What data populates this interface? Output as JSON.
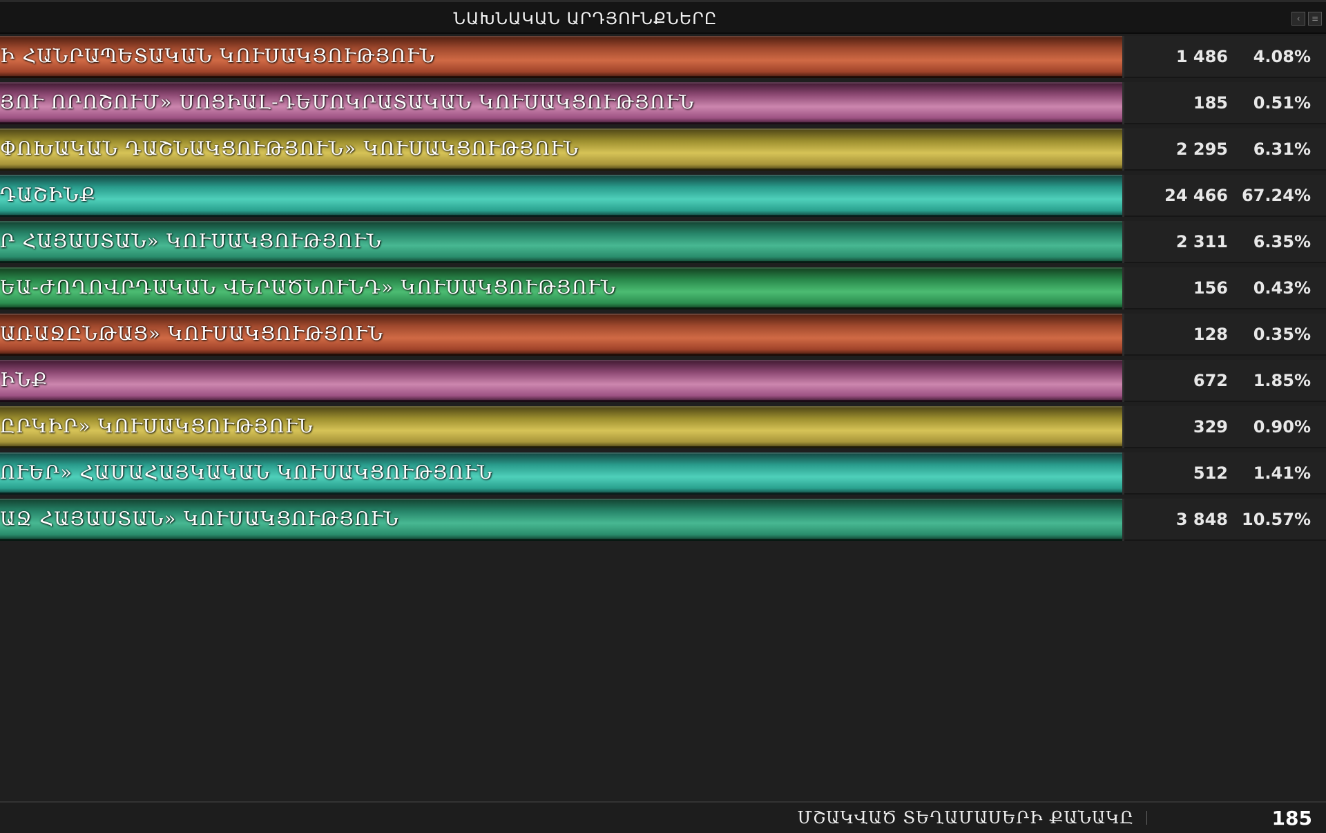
{
  "header": {
    "title": "ՆԱԽՆԱԿԱՆ ԱՐԴՅՈՒՆՔՆԵՐԸ"
  },
  "rows": [
    {
      "label": "Ի ՀԱՆՐԱՊԵՏԱԿԱՆ ԿՈՒՍԱԿՑՈՒԹՅՈՒՆ",
      "votes": "1 486",
      "percent": "4.08%",
      "color": "orange"
    },
    {
      "label": "ՅՈՒ ՈՐՈՇՈՒՄ» ՍՈՑԻԱԼ-ԴԵՄՈԿՐԱՏԱԿԱՆ ԿՈՒՍԱԿՑՈՒԹՅՈՒՆ",
      "votes": "185",
      "percent": "0.51%",
      "color": "pink"
    },
    {
      "label": "ՓՈԽԱԿԱՆ ԴԱՇՆԱԿՑՈՒԹՅՈՒՆ» ԿՈՒՍԱԿՑՈՒԹՅՈՒՆ",
      "votes": "2 295",
      "percent": "6.31%",
      "color": "yellow"
    },
    {
      "label": "ԴԱՇԻՆՔ",
      "votes": "24 466",
      "percent": "67.24%",
      "color": "cyan"
    },
    {
      "label": "Ր ՀԱՅԱՍՏԱՆ» ԿՈՒՍԱԿՑՈՒԹՅՈՒՆ",
      "votes": "2 311",
      "percent": "6.35%",
      "color": "teal"
    },
    {
      "label": "ԵԱ-ԺՈՂՈՎՐԴԱԿԱՆ ՎԵՐԱԾՆՈՒՆԴ» ԿՈՒՍԱԿՑՈՒԹՅՈՒՆ",
      "votes": "156",
      "percent": "0.43%",
      "color": "green"
    },
    {
      "label": "ԱՌԱՋԸՆԹԱՑ» ԿՈՒՍԱԿՑՈՒԹՅՈՒՆ",
      "votes": "128",
      "percent": "0.35%",
      "color": "orange"
    },
    {
      "label": "ԻՆՔ",
      "votes": "672",
      "percent": "1.85%",
      "color": "pink"
    },
    {
      "label": "ԸՐԿԻՐ» ԿՈՒՍԱԿՑՈՒԹՅՈՒՆ",
      "votes": "329",
      "percent": "0.90%",
      "color": "yellow"
    },
    {
      "label": "ՈՒԵՐ» ՀԱՄԱՀԱՅԿԱԿԱՆ ԿՈՒՍԱԿՑՈՒԹՅՈՒՆ",
      "votes": "512",
      "percent": "1.41%",
      "color": "cyan"
    },
    {
      "label": "ԱՋ ՀԱՅԱՍՏԱՆ» ԿՈՒՍԱԿՑՈՒԹՅՈՒՆ",
      "votes": "3 848",
      "percent": "10.57%",
      "color": "teal"
    }
  ],
  "footer": {
    "label": "ՄՇԱԿՎԱԾ ՏԵՂԱՄԱՍԵՐԻ ՔԱՆԱԿԸ",
    "value": "185"
  },
  "icons": {
    "collapse": "chevron-left-icon",
    "menu": "menu-icon"
  }
}
